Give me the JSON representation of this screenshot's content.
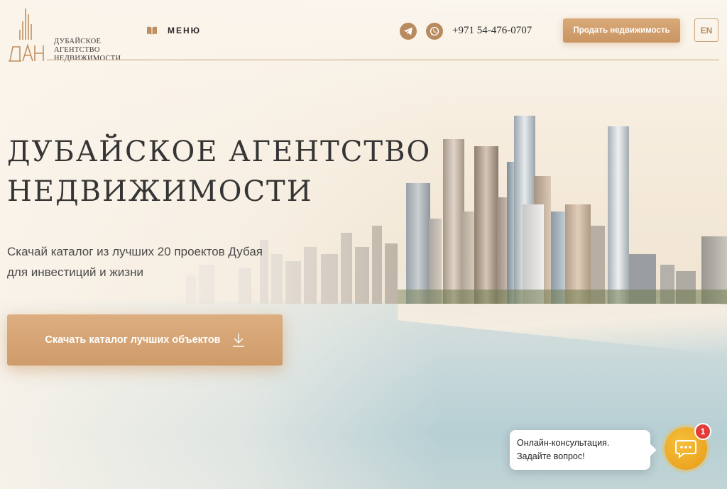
{
  "logo": {
    "monogram": "ДАН",
    "lines": [
      "Дубайское",
      "агентство",
      "недвижимости"
    ]
  },
  "header": {
    "menu_label": "МЕНЮ",
    "phone": "+971 54-476-0707",
    "sell_button": "Продать недвижимость",
    "lang_button": "EN",
    "icons": [
      "telegram-icon",
      "whatsapp-icon",
      "book-icon"
    ]
  },
  "hero": {
    "title_line1": "Дубайское агентство",
    "title_line2": "недвижимости",
    "subtitle_line1": "Скачай каталог из лучших 20 проектов Дубая",
    "subtitle_line2": "для инвестиций и жизни",
    "cta_label": "Скачать каталог лучших объектов"
  },
  "chat": {
    "line1": "Онлайн-консультация.",
    "line2": "Задайте вопрос!",
    "badge": "1"
  },
  "colors": {
    "accent": "#c99563",
    "accent_light": "#dcae80",
    "text_dark": "#353535",
    "chat_yellow": "#f2b02a",
    "badge_red": "#e53a3a"
  }
}
